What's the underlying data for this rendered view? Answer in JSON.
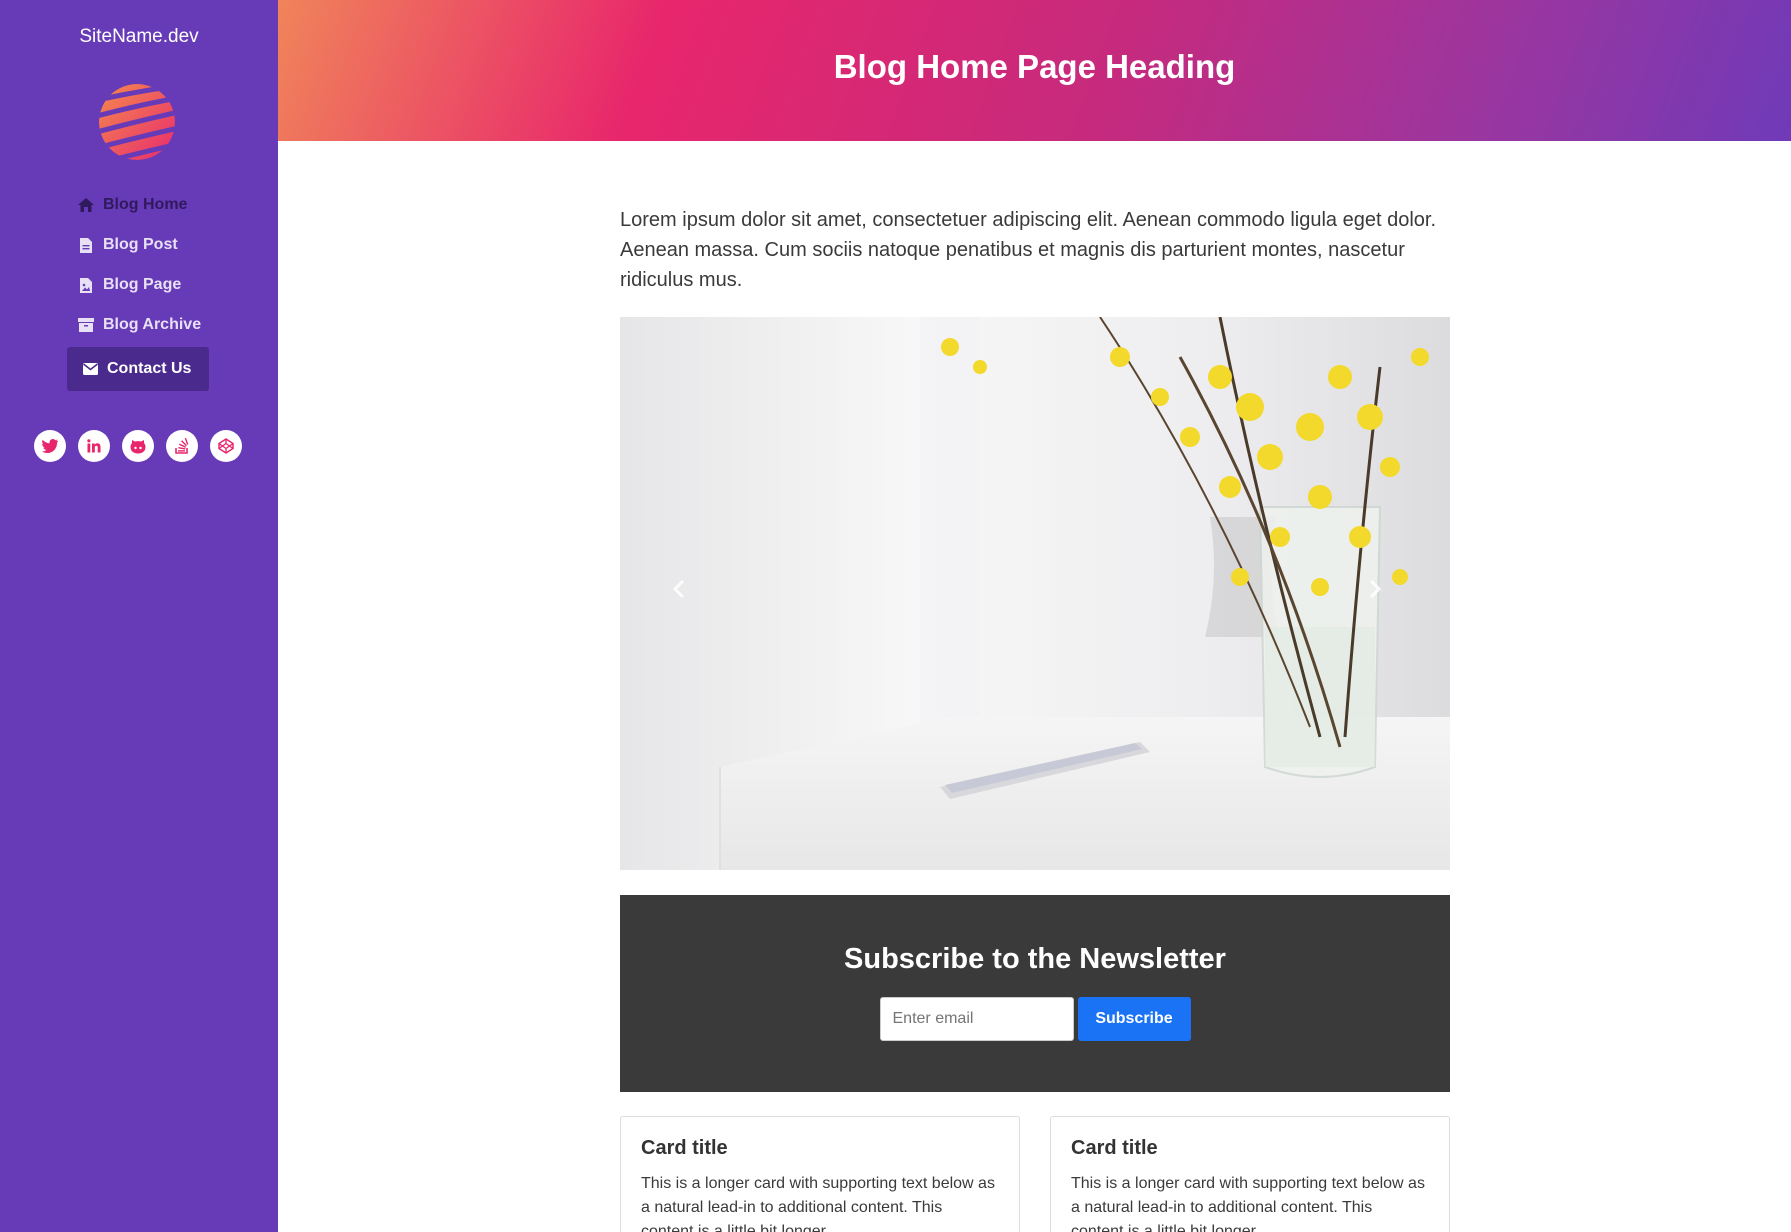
{
  "sidebar": {
    "site_name": "SiteName.dev",
    "nav": [
      {
        "label": "Blog Home",
        "icon": "home-icon",
        "active": true
      },
      {
        "label": "Blog Post",
        "icon": "file-icon"
      },
      {
        "label": "Blog Page",
        "icon": "file-image-icon"
      },
      {
        "label": "Blog Archive",
        "icon": "archive-icon"
      },
      {
        "label": "Contact Us",
        "icon": "envelope-icon"
      }
    ],
    "social": [
      "twitter-icon",
      "linkedin-icon",
      "github-icon",
      "stackoverflow-icon",
      "codepen-icon"
    ],
    "colors": {
      "background": "#673ab7",
      "contact_bg": "#4b2a8e"
    }
  },
  "header": {
    "title": "Blog Home Page Heading"
  },
  "main": {
    "intro": "Lorem ipsum dolor sit amet, consectetuer adipiscing elit. Aenean commodo ligula eget dolor. Aenean massa. Cum sociis natoque penatibus et magnis dis parturient montes, nascetur ridiculus mus.",
    "carousel": {
      "prev_icon": "chevron-left-icon",
      "next_icon": "chevron-right-icon"
    },
    "newsletter": {
      "title": "Subscribe to the Newsletter",
      "placeholder": "Enter email",
      "button": "Subscribe"
    },
    "cards": [
      {
        "title": "Card title",
        "text": "This is a longer card with supporting text below as a natural lead-in to additional content. This content is a little bit longer."
      },
      {
        "title": "Card title",
        "text": "This is a longer card with supporting text below as a natural lead-in to additional content. This content is a little bit longer."
      }
    ]
  },
  "colors": {
    "accent": "#e8266c",
    "button": "#1a73f5",
    "newsletter_bg": "#3a3a3a"
  }
}
